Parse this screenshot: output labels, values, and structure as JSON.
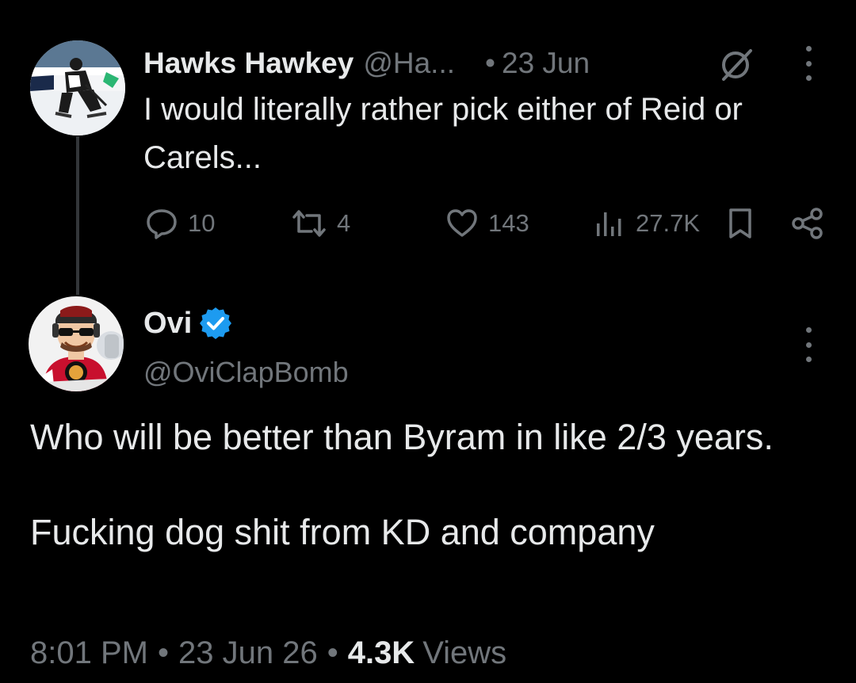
{
  "reply_to": {
    "author_name": "Hawks Hawkey",
    "handle": "@Ha...",
    "dot": "•",
    "time": "23 Jun",
    "text": "I would literally rather pick either of Reid or Carels...",
    "avatar_icon": "hockey-player-avatar",
    "stats": {
      "replies": "10",
      "reposts": "4",
      "likes": "143",
      "views": "27.7K"
    }
  },
  "tweet": {
    "author_name": "Ovi",
    "handle": "@OviClapBomb",
    "verified": true,
    "avatar_icon": "cartoon-hockey-fan-avatar",
    "text": "Who will be better than Byram in like 2/3 years.\n\nFucking dog shit from KD and company",
    "time": "8:01 PM",
    "date": "23 Jun 26",
    "sep": "•",
    "views_count": "4.3K",
    "views_label": "Views"
  },
  "colors": {
    "background": "#000000",
    "primary_text": "#e7e9ea",
    "secondary_text": "#71767b",
    "verified_blue": "#1d9bf0",
    "thread_line": "#333639"
  }
}
